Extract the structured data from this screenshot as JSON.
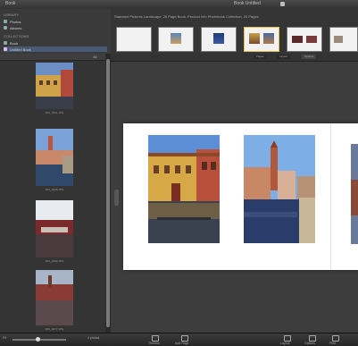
{
  "app": {
    "menu_label": "Book",
    "window_title": "Book Untitled"
  },
  "sidebar": {
    "section_library": "LIBRARY",
    "section_collections": "COLLECTIONS",
    "items": [
      {
        "label": "Photos"
      },
      {
        "label": "Albums"
      },
      {
        "label": "Book"
      },
      {
        "label": "Untitled Book"
      }
    ]
  },
  "thumb_strip": {
    "header": "Standard Pictures Landscape, 20 Page Book. Product Info Photobook Collection, 20 Pages",
    "pages": [
      {
        "caption": "Cover"
      },
      {
        "caption": "1"
      },
      {
        "caption": "2-3"
      },
      {
        "caption": "4-5"
      },
      {
        "caption": "6-7"
      },
      {
        "caption": "8-9"
      }
    ]
  },
  "left_panel": {
    "top_label": "All",
    "photos": [
      {
        "caption": "IMG_0231.JPG"
      },
      {
        "caption": "IMG_0245.JPG"
      },
      {
        "caption": "IMG_0262.JPG"
      },
      {
        "caption": "IMG_0277.JPG"
      }
    ]
  },
  "canvas": {
    "tabs": [
      "Pages",
      "Layout",
      "Options"
    ]
  },
  "statusbar": {
    "zoom_label": "Fit",
    "photos_count": "4 photos",
    "buttons": [
      "Themes",
      "Add Page",
      "Layout",
      "Options",
      "Print"
    ]
  },
  "colors": {
    "accent": "#4a5a74",
    "background": "#2b2b2b",
    "page": "#ffffff"
  }
}
